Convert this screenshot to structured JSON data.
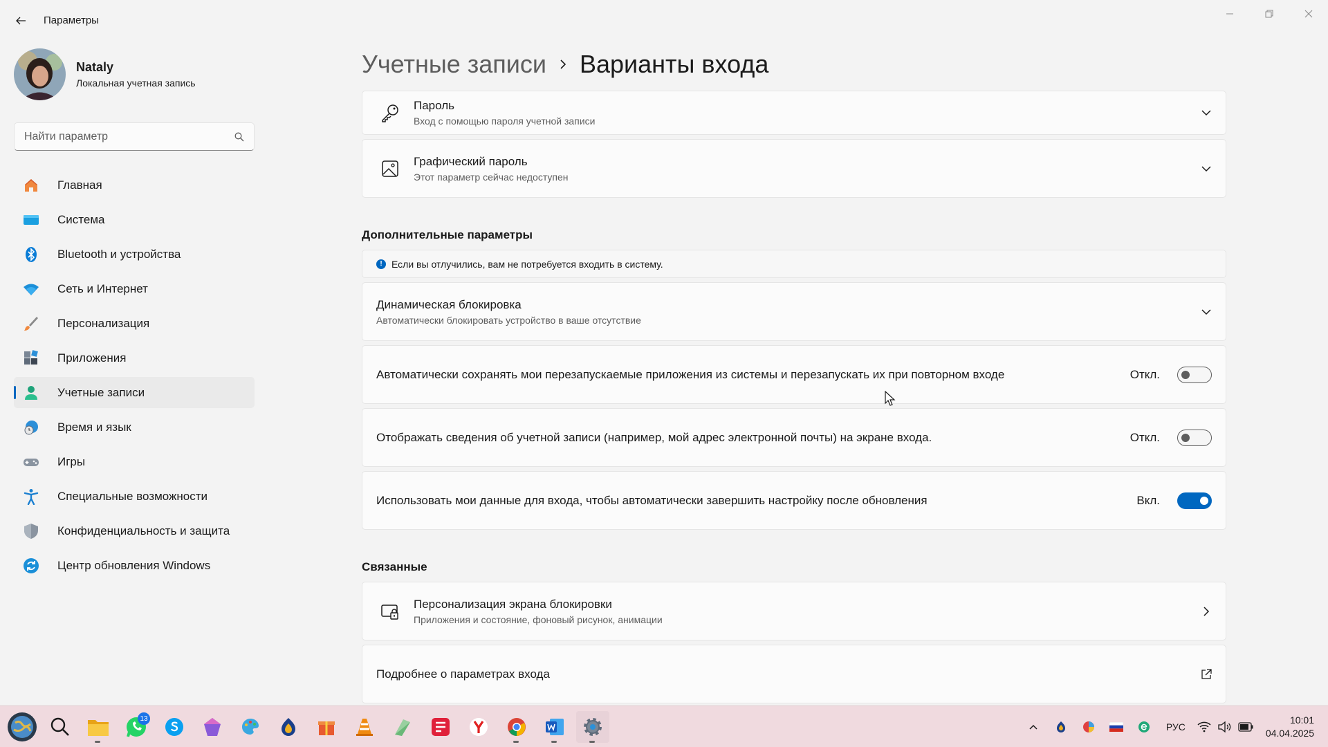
{
  "window": {
    "title": "Параметры",
    "minimize": "Свернуть",
    "maximize": "Развернуть",
    "close": "Закрыть"
  },
  "profile": {
    "name": "Nataly",
    "account_type": "Локальная учетная запись"
  },
  "search": {
    "placeholder": "Найти параметр"
  },
  "nav": {
    "items": [
      {
        "label": "Главная",
        "icon": "home-icon"
      },
      {
        "label": "Система",
        "icon": "system-icon"
      },
      {
        "label": "Bluetooth и устройства",
        "icon": "bluetooth-icon"
      },
      {
        "label": "Сеть и Интернет",
        "icon": "wifi-icon"
      },
      {
        "label": "Персонализация",
        "icon": "brush-icon"
      },
      {
        "label": "Приложения",
        "icon": "apps-icon"
      },
      {
        "label": "Учетные записи",
        "icon": "accounts-icon",
        "active": true
      },
      {
        "label": "Время и язык",
        "icon": "clock-globe-icon"
      },
      {
        "label": "Игры",
        "icon": "gamepad-icon"
      },
      {
        "label": "Специальные возможности",
        "icon": "accessibility-icon"
      },
      {
        "label": "Конфиденциальность и защита",
        "icon": "shield-icon"
      },
      {
        "label": "Центр обновления Windows",
        "icon": "update-icon"
      }
    ]
  },
  "breadcrumb": {
    "parent": "Учетные записи",
    "current": "Варианты входа"
  },
  "sign_in": {
    "password": {
      "title": "Пароль",
      "subtitle": "Вход с помощью пароля учетной записи",
      "icon": "key-icon"
    },
    "picture_password": {
      "title": "Графический пароль",
      "subtitle": "Этот параметр сейчас недоступен",
      "icon": "picture-icon"
    }
  },
  "additional": {
    "title": "Дополнительные параметры",
    "info": "Если вы отлучились, вам не потребуется входить в систему.",
    "dynamic_lock": {
      "title": "Динамическая блокировка",
      "subtitle": "Автоматически блокировать устройство в ваше отсутствие"
    },
    "restart_apps": {
      "label": "Автоматически сохранять мои перезапускаемые приложения из системы и перезапускать их при повторном входе",
      "state": "Откл."
    },
    "show_account": {
      "label": "Отображать сведения об учетной записи (например, мой адрес электронной почты) на экране входа.",
      "state": "Откл."
    },
    "use_signin_info": {
      "label": "Использовать мои данные для входа, чтобы автоматически завершить настройку после обновления",
      "state": "Вкл."
    }
  },
  "related": {
    "title": "Связанные",
    "lock_screen": {
      "title": "Персонализация экрана блокировки",
      "subtitle": "Приложения и состояние, фоновый рисунок, анимации",
      "icon": "lock-screen-icon"
    },
    "more_info": {
      "title": "Подробнее о параметрах входа",
      "icon": "external-link-icon"
    }
  },
  "taskbar": {
    "whatsapp_badge": "13",
    "language": "РУС",
    "time": "10:01",
    "date": "04.04.2025"
  },
  "colors": {
    "accent": "#0067c0",
    "taskbar": "#f0dadf",
    "background": "#f3f3f3"
  }
}
